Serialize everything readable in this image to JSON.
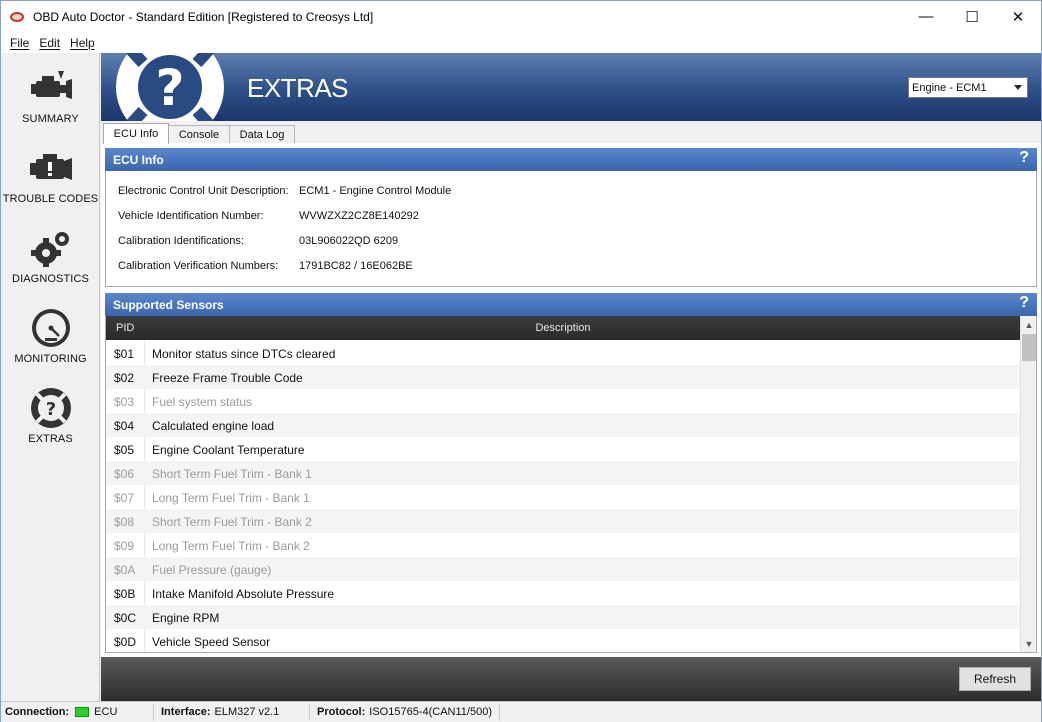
{
  "window": {
    "title": "OBD Auto Doctor - Standard Edition [Registered to Creosys Ltd]",
    "controls": {
      "minimize": "—",
      "maximize": "☐",
      "close": "✕"
    }
  },
  "menu": [
    "File",
    "Edit",
    "Help"
  ],
  "sidebar": {
    "items": [
      {
        "label": "SUMMARY",
        "icon": "engine-icon"
      },
      {
        "label": "TROUBLE CODES",
        "icon": "check-engine-warning-icon"
      },
      {
        "label": "DIAGNOSTICS",
        "icon": "gears-icon"
      },
      {
        "label": "MONITORING",
        "icon": "gauge-icon"
      },
      {
        "label": "EXTRAS",
        "icon": "help-circle-icon"
      }
    ]
  },
  "header": {
    "title": "EXTRAS",
    "logo_glyph": "?",
    "ecu_select": "Engine - ECM1"
  },
  "tabs": [
    "ECU Info",
    "Console",
    "Data Log"
  ],
  "ecu_info": {
    "title": "ECU Info",
    "help": "?",
    "rows": [
      {
        "label": "Electronic Control Unit Description:",
        "value": "ECM1 - Engine Control Module"
      },
      {
        "label": "Vehicle Identification Number:",
        "value": "WVWZXZ2CZ8E140292"
      },
      {
        "label": "Calibration Identifications:",
        "value": "03L906022QD 6209"
      },
      {
        "label": "Calibration Verification Numbers:",
        "value": "1791BC82 / 16E062BE"
      }
    ]
  },
  "sensors": {
    "title": "Supported Sensors",
    "help": "?",
    "columns": {
      "pid": "PID",
      "description": "Description"
    },
    "rows": [
      {
        "pid": "$01",
        "desc": "Monitor status since DTCs cleared",
        "supported": true
      },
      {
        "pid": "$02",
        "desc": "Freeze Frame Trouble Code",
        "supported": true
      },
      {
        "pid": "$03",
        "desc": "Fuel system status",
        "supported": false
      },
      {
        "pid": "$04",
        "desc": "Calculated engine load",
        "supported": true
      },
      {
        "pid": "$05",
        "desc": "Engine Coolant Temperature",
        "supported": true
      },
      {
        "pid": "$06",
        "desc": "Short Term Fuel Trim - Bank 1",
        "supported": false
      },
      {
        "pid": "$07",
        "desc": "Long Term Fuel Trim - Bank 1",
        "supported": false
      },
      {
        "pid": "$08",
        "desc": "Short Term Fuel Trim - Bank 2",
        "supported": false
      },
      {
        "pid": "$09",
        "desc": "Long Term Fuel Trim - Bank 2",
        "supported": false
      },
      {
        "pid": "$0A",
        "desc": "Fuel Pressure (gauge)",
        "supported": false
      },
      {
        "pid": "$0B",
        "desc": "Intake Manifold Absolute Pressure",
        "supported": true
      },
      {
        "pid": "$0C",
        "desc": "Engine RPM",
        "supported": true
      },
      {
        "pid": "$0D",
        "desc": "Vehicle Speed Sensor",
        "supported": true
      }
    ]
  },
  "footer": {
    "refresh": "Refresh"
  },
  "status": {
    "connection_label": "Connection:",
    "connection_value": "ECU",
    "connection_color": "#2bd12b",
    "interface_label": "Interface:",
    "interface_value": "ELM327 v2.1",
    "protocol_label": "Protocol:",
    "protocol_value": "ISO15765-4(CAN11/500)"
  }
}
